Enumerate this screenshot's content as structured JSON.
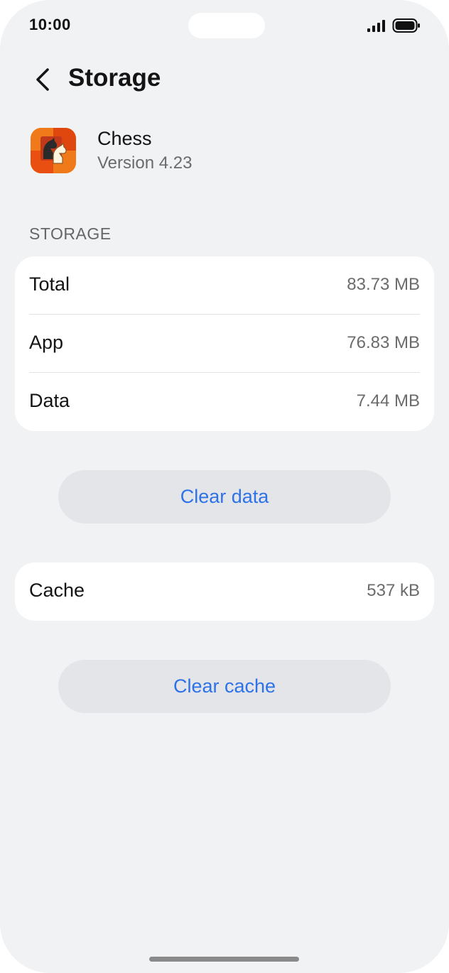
{
  "status_bar": {
    "time": "10:00"
  },
  "header": {
    "title": "Storage",
    "back_icon": "chevron-left-icon"
  },
  "app": {
    "name": "Chess",
    "version": "Version 4.23",
    "icon": "chess-knight-icon"
  },
  "storage_section": {
    "title": "STORAGE",
    "rows": [
      {
        "label": "Total",
        "value": "83.73 MB"
      },
      {
        "label": "App",
        "value": "76.83 MB"
      },
      {
        "label": "Data",
        "value": "7.44 MB"
      }
    ]
  },
  "buttons": {
    "clear_data": "Clear data",
    "clear_cache": "Clear cache"
  },
  "cache": {
    "label": "Cache",
    "value": "537 kB"
  },
  "colors": {
    "background": "#f1f2f4",
    "accent": "#2e72e8",
    "card": "#ffffff",
    "button": "#e4e5e8"
  }
}
